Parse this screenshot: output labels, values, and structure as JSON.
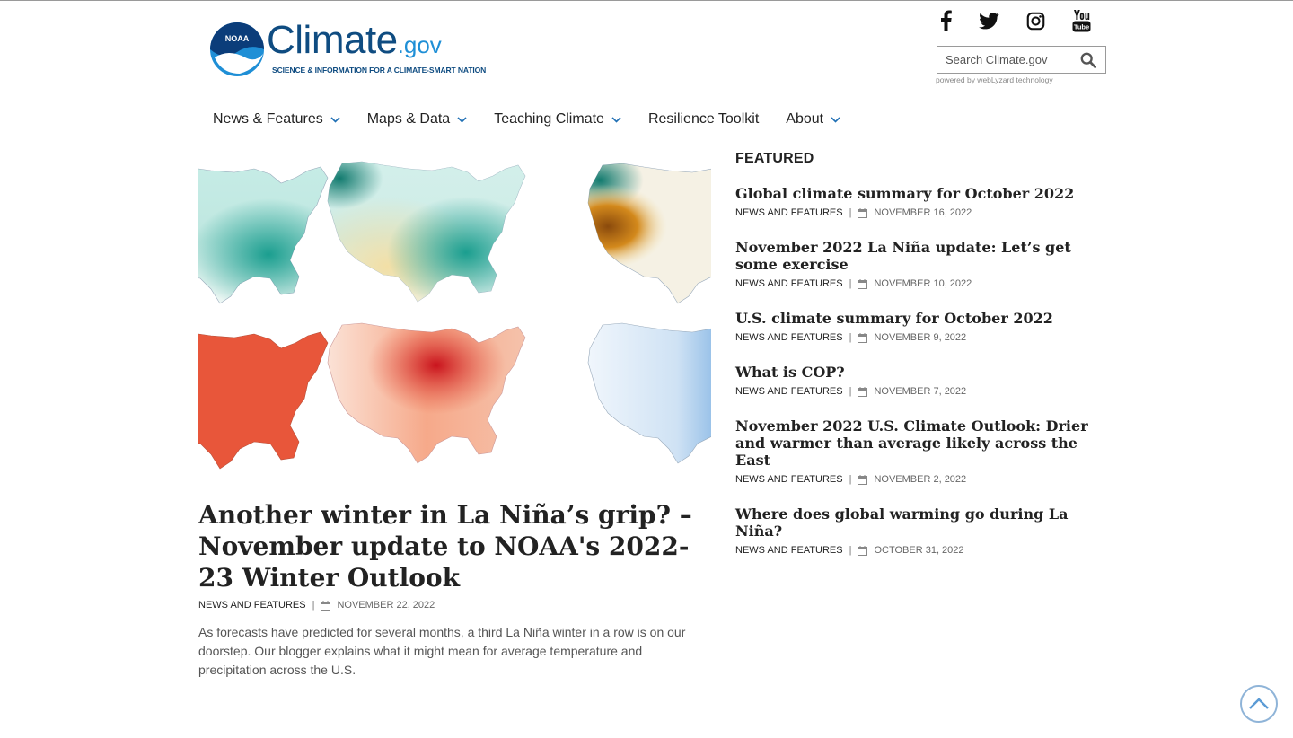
{
  "header": {
    "logo": {
      "badge_text": "NOAA",
      "name_big": "Climate",
      "name_small": ".gov",
      "tagline": "SCIENCE & INFORMATION FOR A CLIMATE-SMART NATION"
    },
    "social": [
      {
        "name": "facebook-icon"
      },
      {
        "name": "twitter-icon"
      },
      {
        "name": "instagram-icon"
      },
      {
        "name": "youtube-icon"
      }
    ],
    "search": {
      "placeholder": "Search Climate.gov",
      "powered_by": "powered by webLyzard technology"
    }
  },
  "nav": {
    "items": [
      {
        "label": "News & Features",
        "has_dropdown": true
      },
      {
        "label": "Maps & Data",
        "has_dropdown": true
      },
      {
        "label": "Teaching Climate",
        "has_dropdown": true
      },
      {
        "label": "Resilience Toolkit",
        "has_dropdown": false
      },
      {
        "label": "About",
        "has_dropdown": true
      }
    ]
  },
  "hero": {
    "title": "Another winter in La Niña’s grip? – November update to NOAA's 2022-23 Winter Outlook",
    "category": "NEWS AND FEATURES",
    "date": "NOVEMBER 22, 2022",
    "description": "As forecasts have predicted for several months, a third La Niña winter in a row is on our doorstep. Our blogger explains what it might mean for average temperature and precipitation across the U.S."
  },
  "featured": {
    "label": "FEATURED",
    "items": [
      {
        "title": "Global climate summary for October 2022",
        "category": "NEWS AND FEATURES",
        "date": "NOVEMBER 16, 2022"
      },
      {
        "title": "November 2022 La Niña update: Let’s get some exercise",
        "category": "NEWS AND FEATURES",
        "date": "NOVEMBER 10, 2022"
      },
      {
        "title": "U.S. climate summary for October 2022",
        "category": "NEWS AND FEATURES",
        "date": "NOVEMBER 9, 2022"
      },
      {
        "title": "What is COP?",
        "category": "NEWS AND FEATURES",
        "date": "NOVEMBER 7, 2022"
      },
      {
        "title": "November 2022 U.S. Climate Outlook: Drier and warmer than average likely across the East",
        "category": "NEWS AND FEATURES",
        "date": "NOVEMBER 2, 2022"
      },
      {
        "title": "Where does global warming go during La Niña?",
        "category": "NEWS AND FEATURES",
        "date": "OCTOBER 31, 2022"
      }
    ]
  },
  "colors": {
    "brand_dark": "#0f4c81",
    "brand_light": "#1f8fd6",
    "precip_wet": "#1a9e8f",
    "precip_dry": "#e8c77a",
    "temp_warm": "#e8563a",
    "temp_cold": "#2a7fd1"
  }
}
